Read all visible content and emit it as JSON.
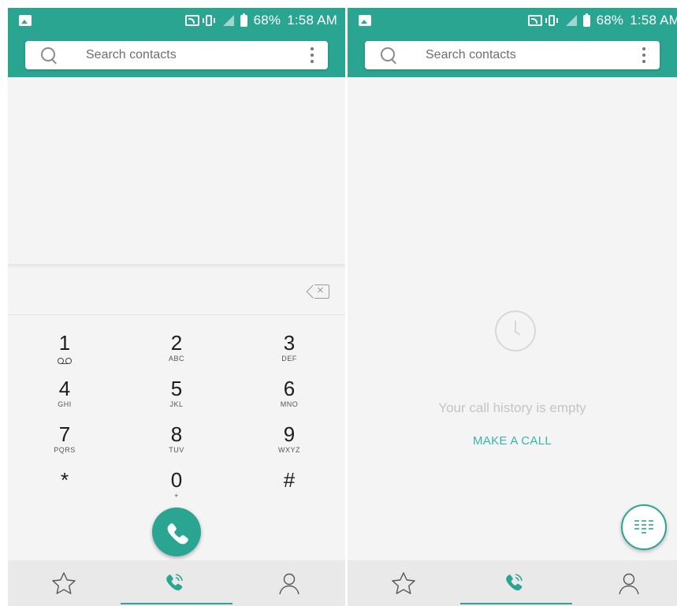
{
  "screens": [
    {
      "name": "dialer",
      "status_bar": {
        "battery": "68%",
        "time": "1:58 AM"
      },
      "search": {
        "placeholder": "Search contacts"
      },
      "keypad": [
        {
          "digit": "1",
          "letters": ""
        },
        {
          "digit": "2",
          "letters": "ABC"
        },
        {
          "digit": "3",
          "letters": "DEF"
        },
        {
          "digit": "4",
          "letters": "GHI"
        },
        {
          "digit": "5",
          "letters": "JKL"
        },
        {
          "digit": "6",
          "letters": "MNO"
        },
        {
          "digit": "7",
          "letters": "PQRS"
        },
        {
          "digit": "8",
          "letters": "TUV"
        },
        {
          "digit": "9",
          "letters": "WXYZ"
        },
        {
          "digit": "*",
          "letters": ""
        },
        {
          "digit": "0",
          "letters": "+"
        },
        {
          "digit": "#",
          "letters": ""
        }
      ]
    },
    {
      "name": "call-history",
      "status_bar": {
        "battery": "68%",
        "time": "1:58 AM"
      },
      "search": {
        "placeholder": "Search contacts"
      },
      "empty_state": {
        "message": "Your call history is empty",
        "action": "MAKE A CALL"
      }
    }
  ],
  "bottom_nav": {
    "items": [
      {
        "icon": "star-icon"
      },
      {
        "icon": "phone-call-icon",
        "active": true
      },
      {
        "icon": "person-icon"
      }
    ]
  },
  "colors": {
    "accent": "#2aa592",
    "background": "#f4f4f4",
    "nav_background": "#e9e9e9"
  }
}
